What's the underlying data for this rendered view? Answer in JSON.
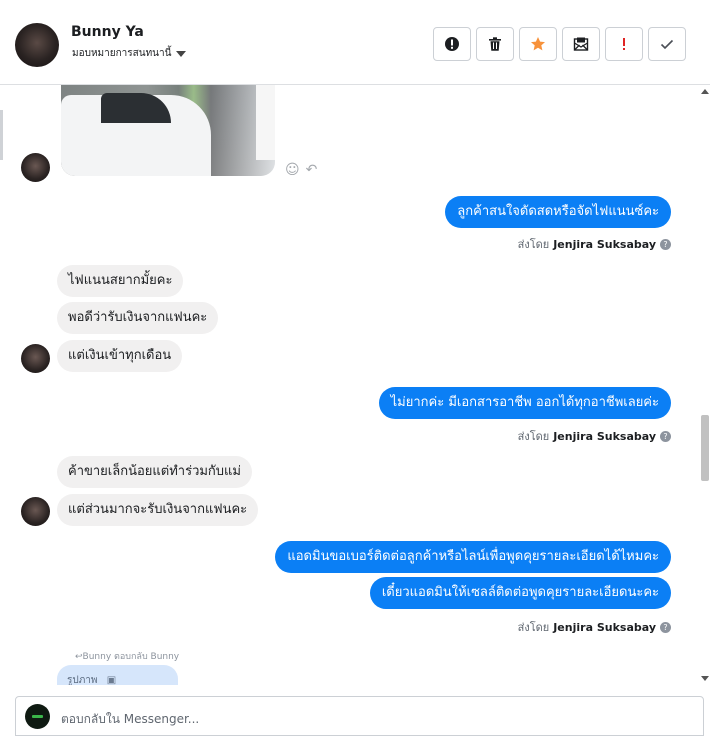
{
  "header": {
    "contact_name": "Bunny Ya",
    "assign_label": "มอบหมายการสนทนานี้",
    "actions": [
      {
        "name": "report-spam-button",
        "icon": "alert-circle-icon"
      },
      {
        "name": "delete-button",
        "icon": "trash-icon"
      },
      {
        "name": "star-button",
        "icon": "star-icon"
      },
      {
        "name": "mark-unread-button",
        "icon": "envelope-icon"
      },
      {
        "name": "follow-up-button",
        "icon": "exclamation-icon"
      },
      {
        "name": "mark-done-button",
        "icon": "check-icon"
      }
    ]
  },
  "messages": {
    "out1": "ลูกค้าสนใจดัดสดหรือจัดไฟแนนซ์คะ",
    "in1": "ไฟแนนสยากมั้ยคะ",
    "in2": "พอดีว่ารับเงินจากแฟนคะ",
    "in3": "แต่เงินเข้าทุกเดือน",
    "out2": "ไม่ยากค่ะ มีเอกสารอาชีพ ออกได้ทุกอาชีพเลยค่ะ",
    "in4": "ค้าขายเล็กน้อยแต่ทำร่วมกับแม่",
    "in5": "แต่ส่วนมากจะรับเงินจากแฟนคะ",
    "out3": "แอดมินขอเบอร์ติดต่อลูกค้าหรือไลน์เพื่อพูดคุยรายละเอียดได้ไหมคะ",
    "out4": "เดี๋ยวแอดมินให้เซลล์ติดต่อพูดคุยรายละเอียดนะคะ"
  },
  "sent_by": {
    "prefix": "ส่งโดย",
    "agent": "Jenjira Suksabay",
    "help": "?"
  },
  "reply": {
    "note": "↩Bunny ตอบกลับ Bunny",
    "preview": "รูปภาพ"
  },
  "composer": {
    "placeholder": "ตอบกลับใน Messenger..."
  },
  "colors": {
    "outgoing_bubble": "#0b7ff5",
    "incoming_bubble": "#f1f0f0",
    "star": "#f7923b",
    "follow_up": "#e02424"
  }
}
